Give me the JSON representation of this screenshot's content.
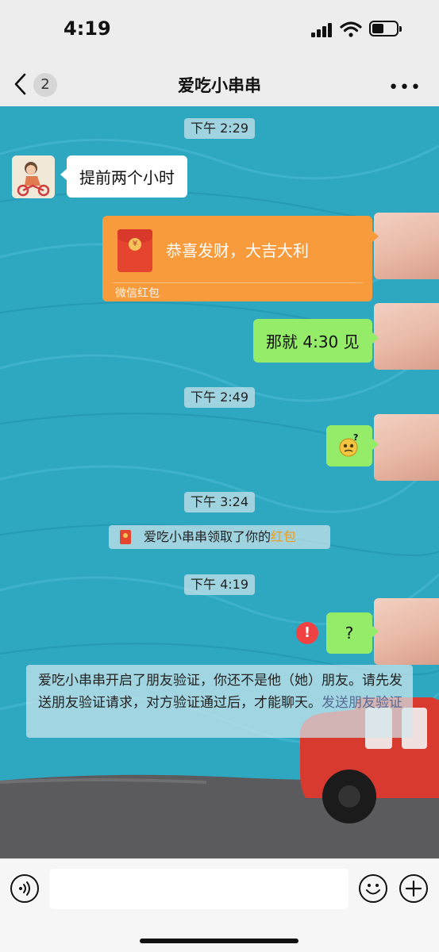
{
  "status_bar": {
    "time": "4:19"
  },
  "nav": {
    "unread_count": "2",
    "title": "爱吃小串串",
    "more": "•••"
  },
  "messages": {
    "ts1": "下午 2:29",
    "m1_text": "提前两个小时",
    "red_packet": {
      "greeting": "恭喜发财，大吉大利",
      "label": "微信红包",
      "coin_symbol": "¥"
    },
    "m3_text": "那就 4:30 见",
    "ts2": "下午 2:49",
    "ts3": "下午 3:24",
    "system_note": {
      "prefix": "爱吃小串串领取了你的",
      "link": "红包"
    },
    "ts4": "下午 4:19",
    "m5_text": "?",
    "error_mark": "!",
    "verify_notice": {
      "text": "爱吃小串串开启了朋友验证，你还不是他（她）朋友。请先发送朋友验证请求，对方验证通过后，才能聊天。",
      "link": "发送朋友验证"
    }
  },
  "input_bar": {
    "placeholder": ""
  },
  "colors": {
    "chat_bg": "#2ea7c1",
    "self_bubble": "#95ec69",
    "red_packet": "#f79b3c",
    "error": "#f04242",
    "link": "#576b95"
  },
  "icons": [
    "back-chevron-icon",
    "signal-icon",
    "wifi-icon",
    "battery-icon",
    "voice-icon",
    "emoji-icon",
    "plus-icon",
    "red-packet-icon",
    "error-icon"
  ]
}
